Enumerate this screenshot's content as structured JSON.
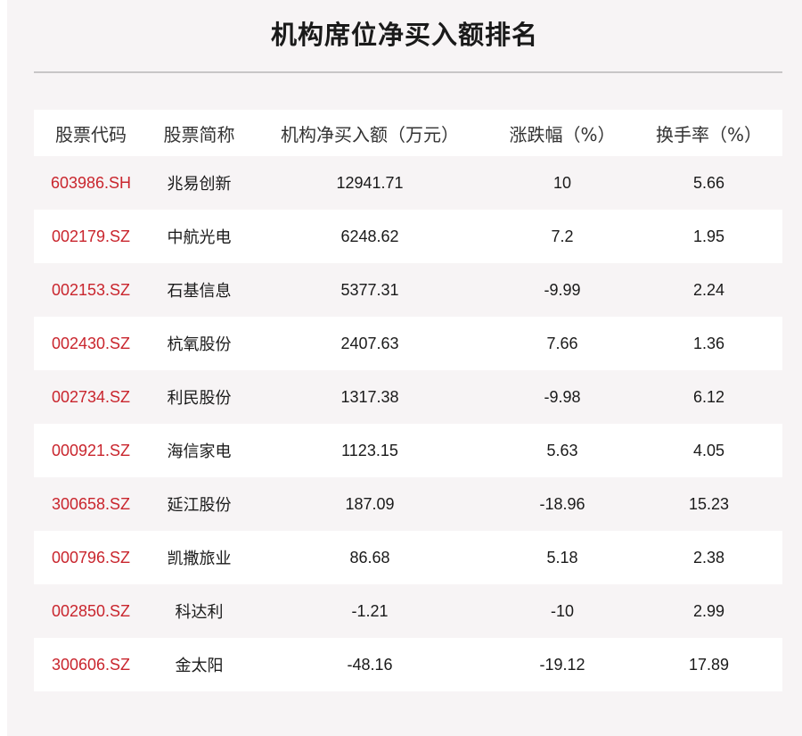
{
  "title": "机构席位净买入额排名",
  "colors": {
    "code_text": "#c9252d",
    "background": "#f7f4f5",
    "row_alt": "#ffffff"
  },
  "chart_data": {
    "type": "table",
    "title": "机构席位净买入额排名",
    "columns": [
      "股票代码",
      "股票简称",
      "机构净买入额（万元）",
      "涨跌幅（%）",
      "换手率（%）"
    ],
    "rows": [
      [
        "603986.SH",
        "兆易创新",
        "12941.71",
        "10",
        "5.66"
      ],
      [
        "002179.SZ",
        "中航光电",
        "6248.62",
        "7.2",
        "1.95"
      ],
      [
        "002153.SZ",
        "石基信息",
        "5377.31",
        "-9.99",
        "2.24"
      ],
      [
        "002430.SZ",
        "杭氧股份",
        "2407.63",
        "7.66",
        "1.36"
      ],
      [
        "002734.SZ",
        "利民股份",
        "1317.38",
        "-9.98",
        "6.12"
      ],
      [
        "000921.SZ",
        "海信家电",
        "1123.15",
        "5.63",
        "4.05"
      ],
      [
        "300658.SZ",
        "延江股份",
        "187.09",
        "-18.96",
        "15.23"
      ],
      [
        "000796.SZ",
        "凯撒旅业",
        "86.68",
        "5.18",
        "2.38"
      ],
      [
        "002850.SZ",
        "科达利",
        "-1.21",
        "-10",
        "2.99"
      ],
      [
        "300606.SZ",
        "金太阳",
        "-48.16",
        "-19.12",
        "17.89"
      ]
    ]
  }
}
